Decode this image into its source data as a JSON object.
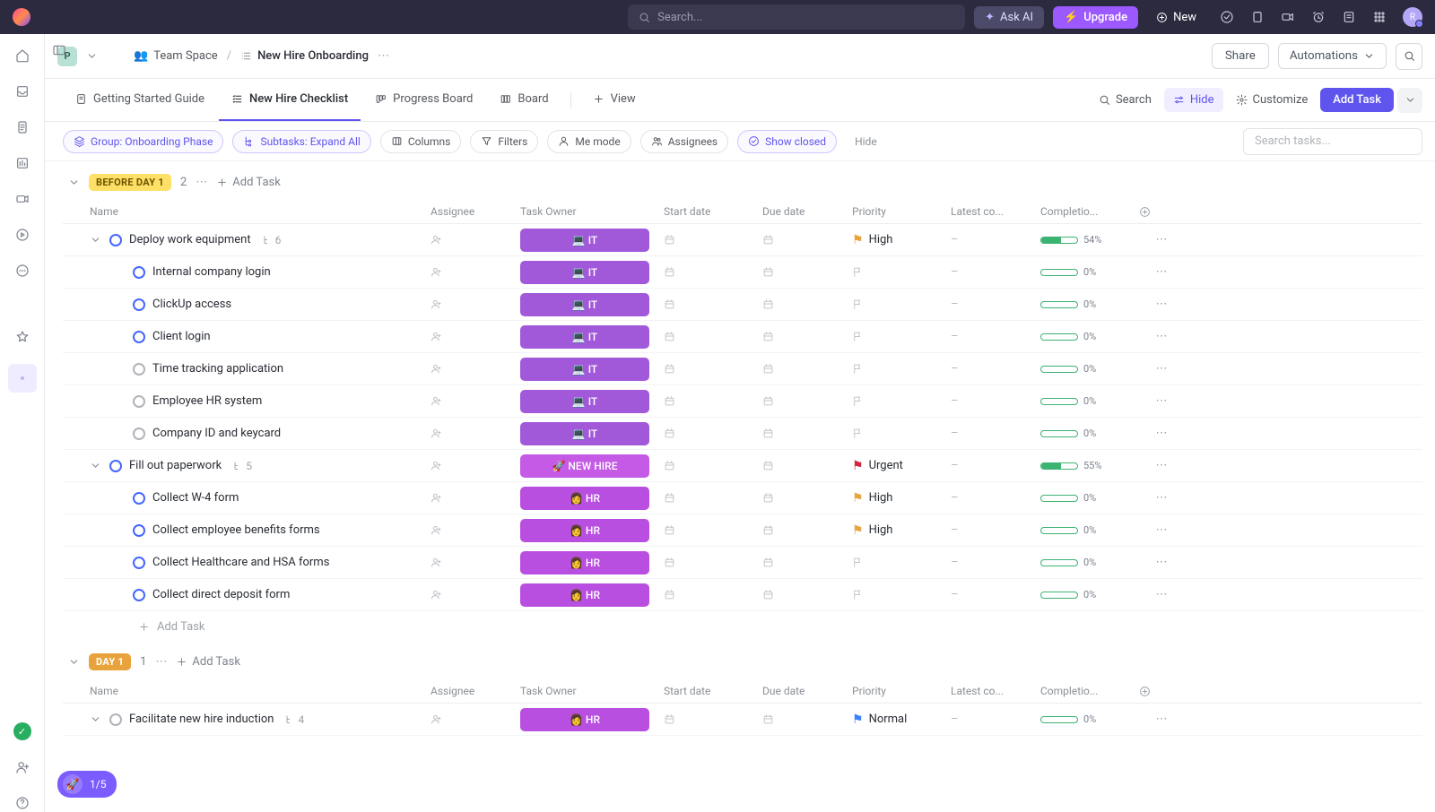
{
  "topbar": {
    "search_placeholder": "Search...",
    "ask_ai": "Ask AI",
    "upgrade": "Upgrade",
    "new": "New",
    "avatar_initial": "R"
  },
  "breadcrumb": {
    "workspace_initial": "P",
    "space": "Team Space",
    "list": "New Hire Onboarding",
    "share": "Share",
    "automations": "Automations"
  },
  "tabs": {
    "items": [
      "Getting Started Guide",
      "New Hire Checklist",
      "Progress Board",
      "Board"
    ],
    "active_index": 1,
    "add_view": "View",
    "search": "Search",
    "hide": "Hide",
    "customize": "Customize",
    "add_task": "Add Task"
  },
  "chips": {
    "group": "Group: Onboarding Phase",
    "subtasks": "Subtasks: Expand All",
    "columns": "Columns",
    "filters": "Filters",
    "me_mode": "Me mode",
    "assignees": "Assignees",
    "show_closed": "Show closed",
    "hide": "Hide",
    "search_tasks_placeholder": "Search tasks..."
  },
  "columns": [
    "Name",
    "Assignee",
    "Task Owner",
    "Start date",
    "Due date",
    "Priority",
    "Latest co...",
    "Completio..."
  ],
  "groups": [
    {
      "label": "BEFORE DAY 1",
      "badge_class": "yellow",
      "count": "2",
      "add_task": "Add Task",
      "rows": [
        {
          "indent": 0,
          "expand": true,
          "status": "open",
          "name": "Deploy work equipment",
          "sub": "6",
          "owner": "💻 IT",
          "owner_class": "owner-it",
          "priority": "High",
          "prio_class": "high",
          "completion": 54
        },
        {
          "indent": 1,
          "status": "open",
          "name": "Internal company login",
          "owner": "💻 IT",
          "owner_class": "owner-it",
          "priority": "",
          "prio_class": "none",
          "completion": 0
        },
        {
          "indent": 1,
          "status": "open",
          "name": "ClickUp access",
          "owner": "💻 IT",
          "owner_class": "owner-it",
          "priority": "",
          "prio_class": "none",
          "completion": 0
        },
        {
          "indent": 1,
          "status": "open",
          "name": "Client login",
          "owner": "💻 IT",
          "owner_class": "owner-it",
          "priority": "",
          "prio_class": "none",
          "completion": 0
        },
        {
          "indent": 1,
          "status": "grey",
          "name": "Time tracking application",
          "owner": "💻 IT",
          "owner_class": "owner-it",
          "priority": "",
          "prio_class": "none",
          "completion": 0
        },
        {
          "indent": 1,
          "status": "grey",
          "name": "Employee HR system",
          "owner": "💻 IT",
          "owner_class": "owner-it",
          "priority": "",
          "prio_class": "none",
          "completion": 0
        },
        {
          "indent": 1,
          "status": "grey",
          "name": "Company ID and keycard",
          "owner": "💻 IT",
          "owner_class": "owner-it",
          "priority": "",
          "prio_class": "none",
          "completion": 0
        },
        {
          "indent": 0,
          "expand": true,
          "status": "open",
          "name": "Fill out paperwork",
          "sub": "5",
          "owner": "🚀 NEW HIRE",
          "owner_class": "owner-nh",
          "priority": "Urgent",
          "prio_class": "urgent",
          "completion": 55
        },
        {
          "indent": 1,
          "status": "open",
          "name": "Collect W-4 form",
          "owner": "👩 HR",
          "owner_class": "owner-hr",
          "priority": "High",
          "prio_class": "high",
          "completion": 0
        },
        {
          "indent": 1,
          "status": "open",
          "name": "Collect employee benefits forms",
          "owner": "👩 HR",
          "owner_class": "owner-hr",
          "priority": "High",
          "prio_class": "high",
          "completion": 0
        },
        {
          "indent": 1,
          "status": "open",
          "name": "Collect Healthcare and HSA forms",
          "owner": "👩 HR",
          "owner_class": "owner-hr",
          "priority": "",
          "prio_class": "none",
          "completion": 0
        },
        {
          "indent": 1,
          "status": "open",
          "name": "Collect direct deposit form",
          "owner": "👩 HR",
          "owner_class": "owner-hr",
          "priority": "",
          "prio_class": "none",
          "completion": 0
        }
      ],
      "footer_add": "Add Task"
    },
    {
      "label": "DAY 1",
      "badge_class": "orange",
      "count": "1",
      "add_task": "Add Task",
      "rows": [
        {
          "indent": 0,
          "expand": true,
          "status": "grey",
          "name": "Facilitate new hire induction",
          "sub": "4",
          "owner": "👩 HR",
          "owner_class": "owner-hr",
          "priority": "Normal",
          "prio_class": "normal",
          "completion": 0
        }
      ]
    }
  ],
  "onboarding": "1/5"
}
